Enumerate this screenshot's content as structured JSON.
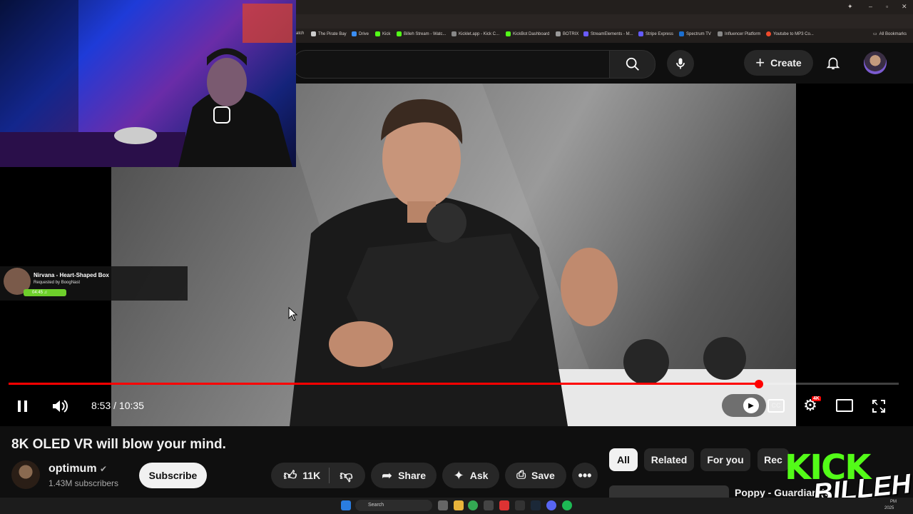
{
  "bookmarks": [
    "atch",
    "The Pirate Bay",
    "Drive",
    "Kick",
    "Billeh Stream - Watc...",
    "Kicklet.app - Kick C...",
    "KickBot Dashboard",
    "BOTRIX",
    "StreamElements - M...",
    "Stripe Express",
    "Spectrum TV",
    "Influencer Platform",
    "Youtube to MP3 Co..."
  ],
  "bookmarks_all": "All Bookmarks",
  "header": {
    "create_label": "Create"
  },
  "overlay": {
    "song_title": "Nirvana - Heart-Shaped Box",
    "requested_by": "Requested by BoogNast",
    "song_time": "04:45"
  },
  "player": {
    "time": "8:53 / 10:35",
    "progress_fraction": 0.843,
    "quality_badge": "4K"
  },
  "video": {
    "title": "8K OLED VR will blow your mind."
  },
  "channel": {
    "name": "optimum",
    "subscribers": "1.43M subscribers",
    "subscribe_label": "Subscribe"
  },
  "actions": {
    "likes": "11K",
    "share": "Share",
    "ask": "Ask",
    "save": "Save"
  },
  "chips": [
    "All",
    "Related",
    "For you",
    "Rec"
  ],
  "recommended": {
    "title": "Poppy - Guardian (C"
  },
  "taskbar": {
    "search_placeholder": "Search",
    "clock": "PM",
    "date": "2025"
  },
  "branding": {
    "kick": "KICK",
    "billeh": "BILLEH"
  }
}
